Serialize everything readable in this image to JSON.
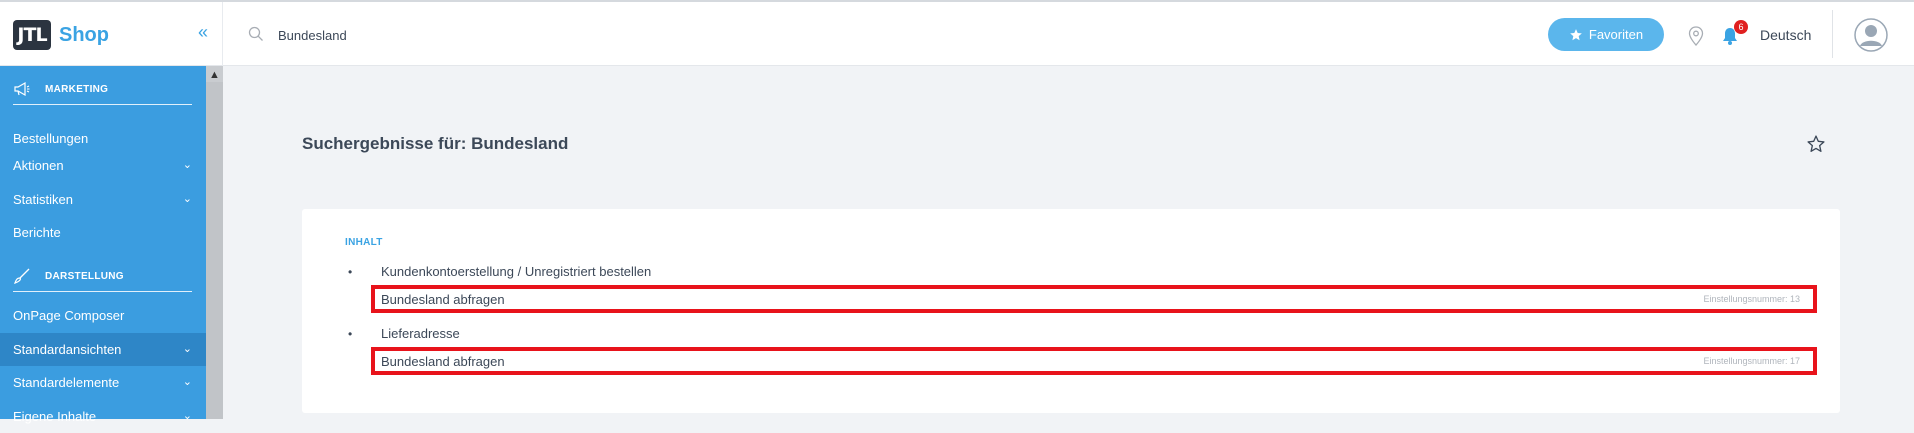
{
  "header": {
    "logo_mark": "JTL",
    "logo_text": "Shop",
    "collapse_glyph": "«",
    "search_value": "Bundesland",
    "favorites_label": "Favoriten",
    "notification_count": "6",
    "language": "Deutsch"
  },
  "sidebar": {
    "sections": [
      {
        "title": "MARKETING",
        "icon": "megaphone-icon"
      },
      {
        "title": "DARSTELLUNG",
        "icon": "brush-icon"
      }
    ],
    "items": [
      {
        "label": "Bestellungen",
        "chevron": false
      },
      {
        "label": "Aktionen",
        "chevron": true
      },
      {
        "label": "Statistiken",
        "chevron": true
      },
      {
        "label": "Berichte",
        "chevron": false
      },
      {
        "label": "OnPage Composer",
        "chevron": false
      },
      {
        "label": "Standardansichten",
        "chevron": true,
        "active": true
      },
      {
        "label": "Standardelemente",
        "chevron": true
      },
      {
        "label": "Eigene Inhalte",
        "chevron": true
      }
    ]
  },
  "main": {
    "title": "Suchergebnisse für: Bundesland",
    "card_label": "INHALT",
    "groups": [
      {
        "title": "Kundenkontoerstellung / Unregistriert bestellen",
        "result": "Bundesland abfragen",
        "setting_number": "Einstellungsnummer: 13"
      },
      {
        "title": "Lieferadresse",
        "result": "Bundesland abfragen",
        "setting_number": "Einstellungsnummer: 17"
      }
    ]
  },
  "colors": {
    "sidebar_bg": "#3b9de0",
    "sidebar_active": "#2e86c7",
    "accent": "#3aa3e3",
    "favorites_btn": "#5bb6ec",
    "highlight_border": "#e8131b",
    "badge": "#e02020"
  }
}
